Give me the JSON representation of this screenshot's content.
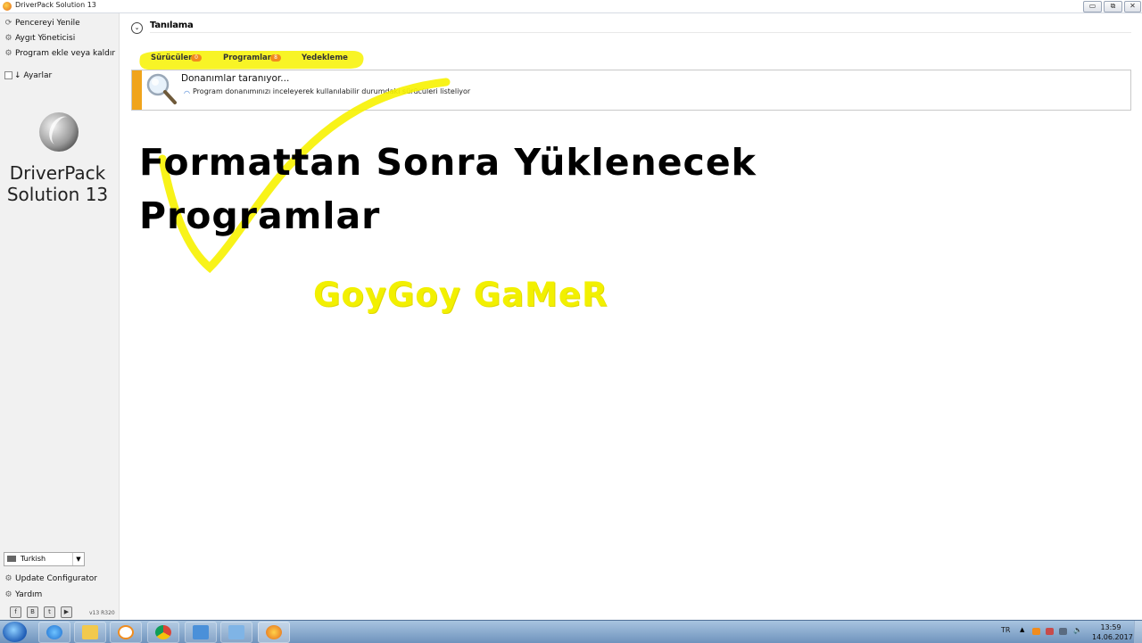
{
  "window": {
    "title": "DriverPack Solution 13",
    "controls": [
      "▭",
      "⧉",
      "✕"
    ]
  },
  "sidebar": {
    "items": [
      {
        "icon": "refresh-icon",
        "label": "Pencereyi Yenile"
      },
      {
        "icon": "gear-icon",
        "label": "Aygıt Yöneticisi"
      },
      {
        "icon": "programs-icon",
        "label": "Program ekle veya kaldır"
      }
    ],
    "settings_label": "↓ Ayarlar",
    "logo_line1": "DriverPack",
    "logo_line2": "Solution 13",
    "language": {
      "selected": "Turkish"
    },
    "bottom_items": [
      {
        "icon": "gear-icon",
        "label": "Update Configurator"
      },
      {
        "icon": "help-icon",
        "label": "Yardım"
      }
    ],
    "social": [
      "f",
      "B",
      "t",
      "▶"
    ],
    "version": "v13 R320"
  },
  "main": {
    "section_title": "Tanılama",
    "tabs": [
      {
        "label": "Sürücüler",
        "badge": "0"
      },
      {
        "label": "Programlar",
        "badge": "8"
      },
      {
        "label": "Yedekleme",
        "badge": ""
      }
    ],
    "scan_panel": {
      "heading": "Donanımlar taranıyor...",
      "description": "Program donanımınızı inceleyerek kullanılabilir durumdaki sürücüleri listeliyor"
    },
    "overlay_line1": "Formattan Sonra Yüklenecek",
    "overlay_line2": "Programlar",
    "overlay_signature": "GoyGoy GaMeR"
  },
  "taskbar": {
    "language": "TR",
    "time": "13:59",
    "date": "14.06.2017"
  },
  "colors": {
    "highlight_yellow": "#f7f200",
    "badge_orange": "#f18b1d",
    "stripe_orange": "#f0a41c",
    "taskbar_blue": "#7fa3cb"
  }
}
